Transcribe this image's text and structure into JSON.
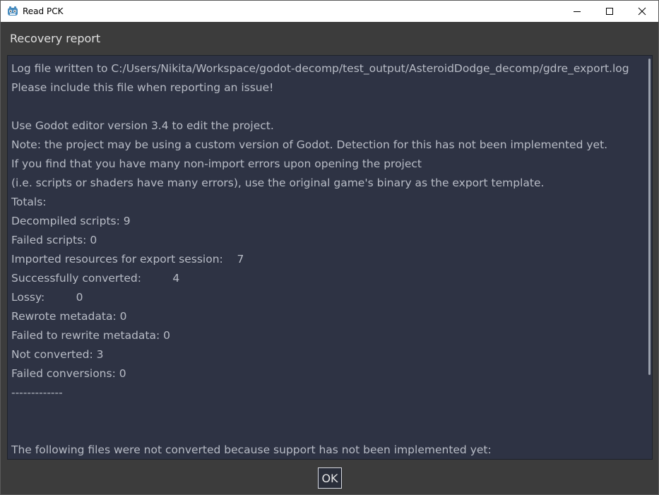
{
  "window": {
    "title": "Read PCK",
    "controls": {
      "minimize_icon": "minimize-icon",
      "maximize_icon": "maximize-icon",
      "close_icon": "close-icon"
    }
  },
  "dialog": {
    "title": "Recovery report",
    "report_lines": [
      "Log file written to C:/Users/Nikita/Workspace/godot-decomp/test_output/AsteroidDodge_decomp/gdre_export.log",
      "Please include this file when reporting an issue!",
      "",
      "Use Godot editor version 3.4 to edit the project.",
      "Note: the project may be using a custom version of Godot. Detection for this has not been implemented yet.",
      "If you find that you have many non-import errors upon opening the project",
      "(i.e. scripts or shaders have many errors), use the original game's binary as the export template.",
      "Totals:",
      "Decompiled scripts: 9",
      "Failed scripts: 0",
      "Imported resources for export session:    7",
      "Successfully converted:         4",
      "Lossy:         0",
      "Rewrote metadata: 0",
      "Failed to rewrite metadata: 0",
      "Not converted: 3",
      "Failed conversions: 0",
      "-------------",
      "",
      "",
      "The following files were not converted because support has not been implemented yet:"
    ],
    "ok_label": "OK"
  },
  "colors": {
    "window_bg": "#3c3c3c",
    "titlebar_bg": "#ffffff",
    "report_bg": "#2e3344",
    "report_text": "#b8bcc6",
    "dialog_title_text": "#e0e0e0",
    "ok_border": "#d6d9e0"
  }
}
